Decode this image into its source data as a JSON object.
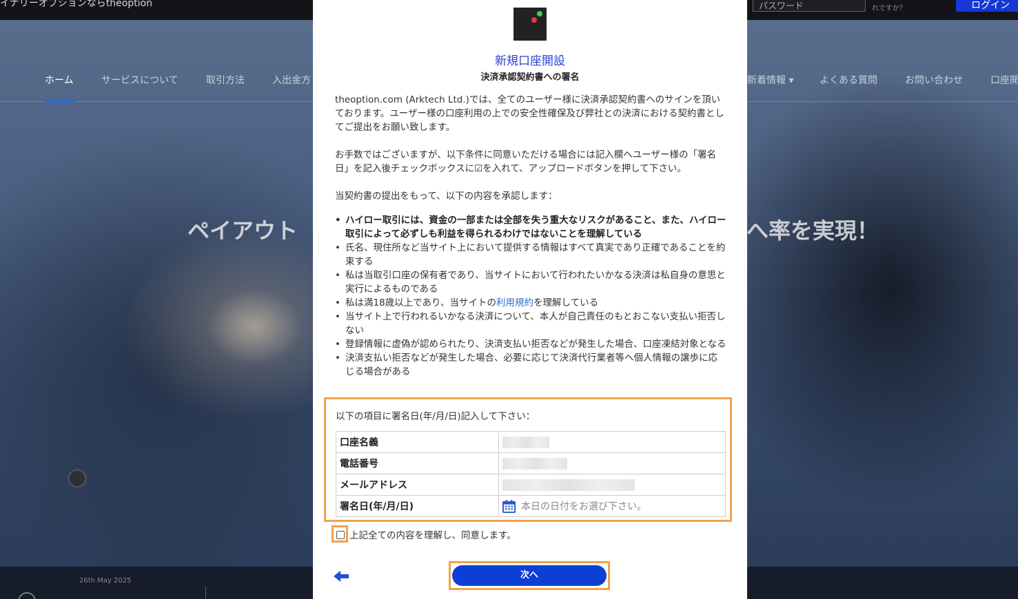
{
  "background": {
    "site_title": "イナリーオプションならtheoption",
    "password_placeholder": "パスワード",
    "forgot_text": "れですか？",
    "login_label": "ログイン",
    "nav": [
      "ホーム",
      "サービスについて",
      "取引方法",
      "入出金方",
      "新着情報 ▾",
      "よくある質問",
      "お問い合わせ",
      "口座開"
    ],
    "hero_left": "ペイアウト",
    "hero_right": "へ率を実現！",
    "date_text": "26th May 2025"
  },
  "modal": {
    "title": "新規口座開設",
    "subtitle": "決済承認契約書への署名",
    "paragraph1": "theoption.com (Arktech Ltd.)では、全てのユーザー様に決済承認契約書へのサインを頂いております。ユーザー様の口座利用の上での安全性確保及び弊社との決済における契約書としてご提出をお願い致します。",
    "paragraph2": "お手数ではございますが、以下条件に同意いただける場合には記入欄へユーザー様の「署名日」を記入後チェックボックスに☑を入れて、アップロードボタンを押して下さい。",
    "paragraph3": "当契約書の提出をもって、以下の内容を承認します：",
    "terms": [
      "ハイロー取引には、資金の一部または全部を失う重大なリスクがあること、また、ハイロー取引によって必ずしも利益を得られるわけではないことを理解している",
      "氏名、現住所など当サイト上において提供する情報はすべて真実であり正確であることを約束する",
      "私は当取引口座の保有者であり、当サイトにおいて行われたいかなる決済は私自身の意思と実行によるものである",
      "当サイト上で行われるいかなる決済について、本人が自己責任のもとおこない支払い拒否しない",
      "登録情報に虚偽が認められたり、決済支払い拒否などが発生した場合、口座凍結対象となる",
      "決済支払い拒否などが発生した場合、必要に応じて決済代行業者等へ個人情報の譲歩に応じる場合がある"
    ],
    "term_age_before": "私は満18歳以上であり、当サイトの",
    "term_age_link": "利用規約",
    "term_age_after": "を理解している",
    "sign_instruction": "以下の項目に署名日(年/月/日)記入して下さい：",
    "rows": {
      "account_name": "口座名義",
      "phone": "電話番号",
      "email": "メールアドレス",
      "sign_date": "署名日(年/月/日)"
    },
    "date_placeholder": "本日の日付をお選び下さい。",
    "agree_label": "上記全ての内容を理解し、同意します。",
    "next_label": "次へ"
  },
  "colors": {
    "title_blue": "#2a3ed1",
    "button_blue": "#0d3fd6",
    "highlight_orange": "#f2a24a",
    "link_blue": "#2a6bd1"
  }
}
